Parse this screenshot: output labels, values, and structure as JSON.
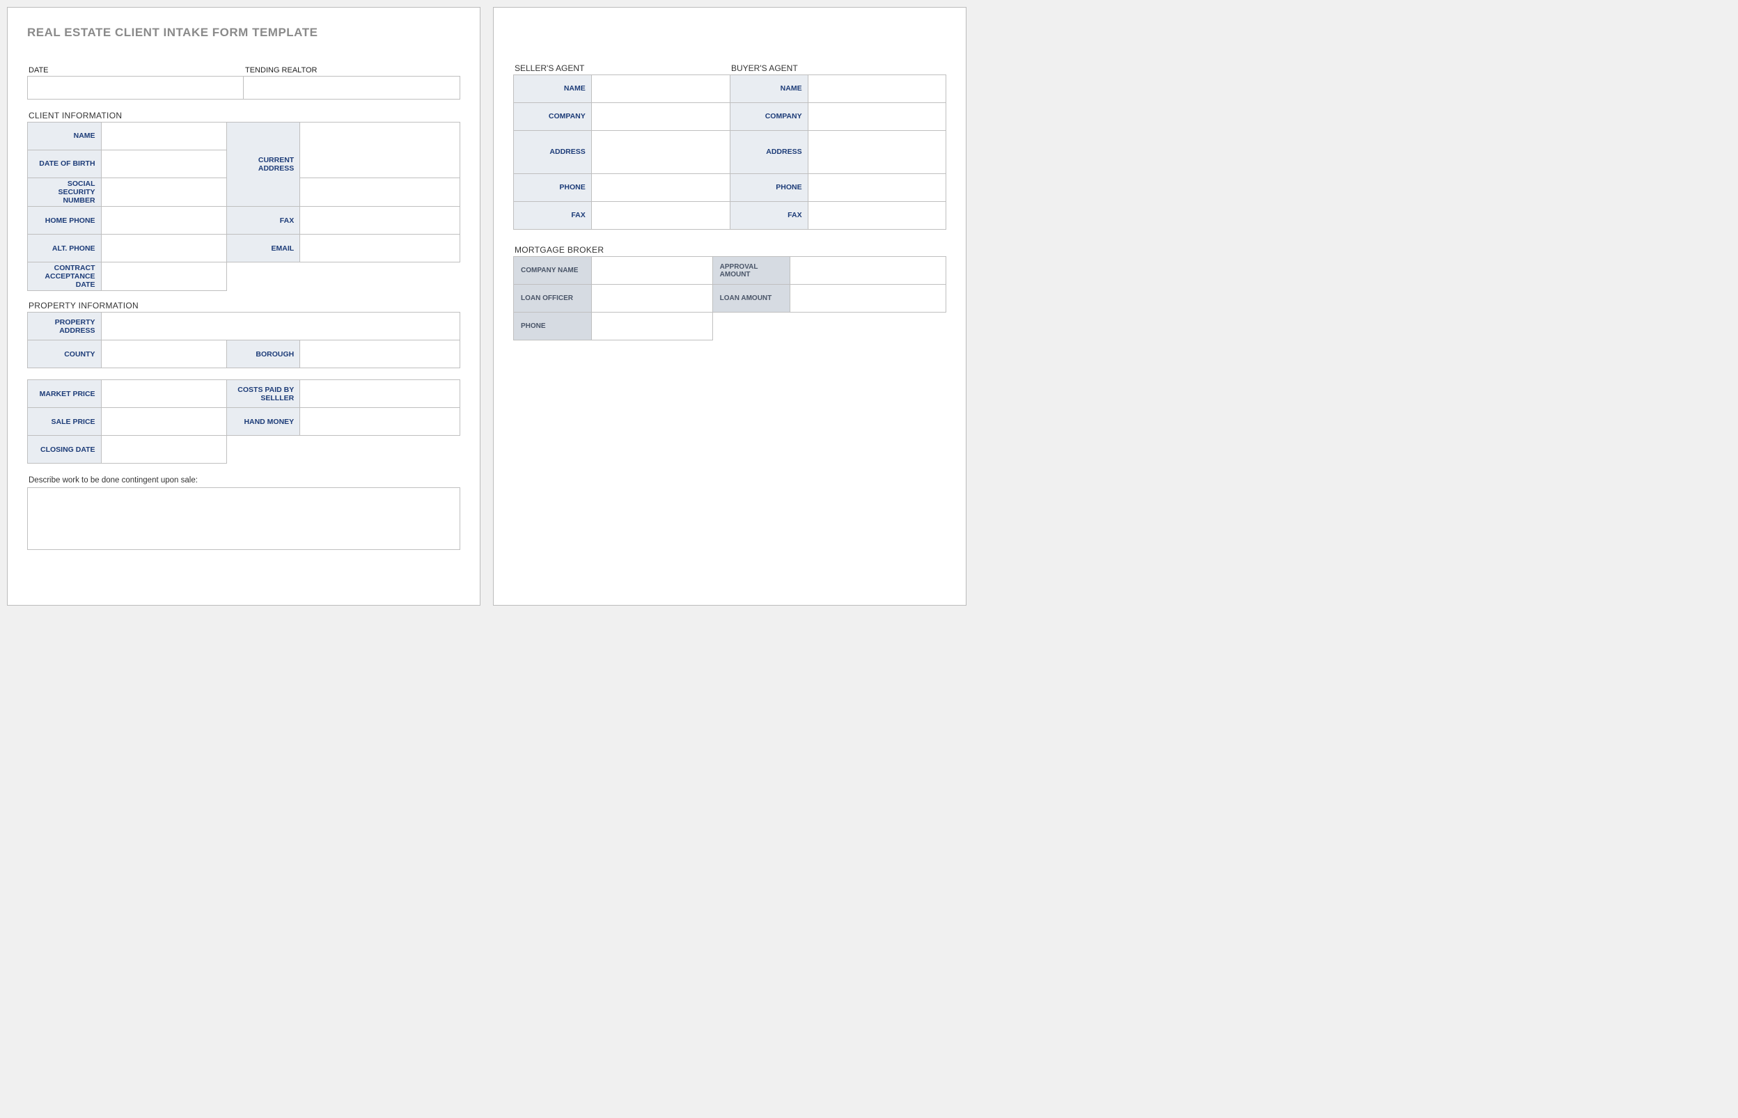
{
  "title": "REAL ESTATE CLIENT INTAKE FORM TEMPLATE",
  "header": {
    "date_label": "DATE",
    "realtor_label": "TENDING REALTOR"
  },
  "client": {
    "section": "CLIENT INFORMATION",
    "name": "NAME",
    "dob": "DATE OF BIRTH",
    "ssn": "SOCIAL SECURITY NUMBER",
    "home_phone": "HOME PHONE",
    "alt_phone": "ALT. PHONE",
    "contract_date": "CONTRACT ACCEPTANCE DATE",
    "address": "CURRENT ADDRESS",
    "fax": "FAX",
    "email": "EMAIL"
  },
  "property": {
    "section": "PROPERTY INFORMATION",
    "address": "PROPERTY ADDRESS",
    "county": "COUNTY",
    "borough": "BOROUGH",
    "market_price": "MARKET PRICE",
    "sale_price": "SALE PRICE",
    "closing_date": "CLOSING DATE",
    "costs_paid": "COSTS PAID BY SELLLER",
    "hand_money": "HAND MONEY"
  },
  "describe_label": "Describe work to be done contingent upon sale:",
  "agents": {
    "seller_title": "SELLER'S AGENT",
    "buyer_title": "BUYER'S AGENT",
    "name": "NAME",
    "company": "COMPANY",
    "address": "ADDRESS",
    "phone": "PHONE",
    "fax": "FAX"
  },
  "broker": {
    "section": "MORTGAGE BROKER",
    "company_name": "COMPANY NAME",
    "loan_officer": "LOAN OFFICER",
    "phone": "PHONE",
    "approval_amount": "APPROVAL AMOUNT",
    "loan_amount": "LOAN AMOUNT"
  }
}
